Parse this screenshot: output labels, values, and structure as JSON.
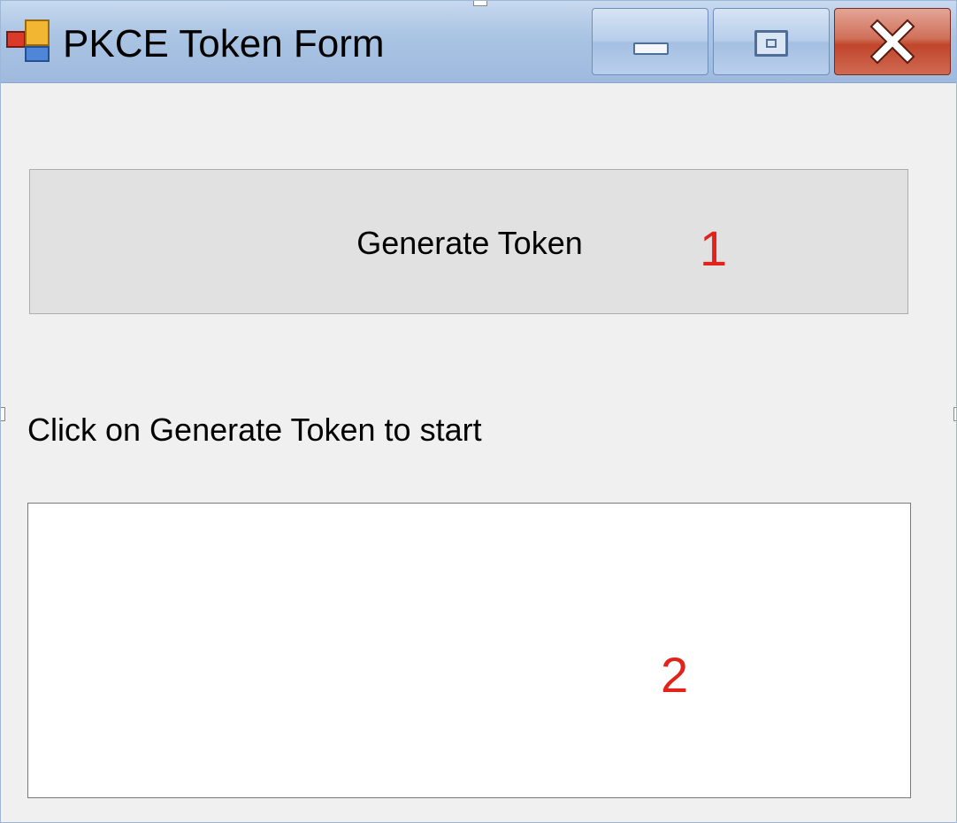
{
  "window": {
    "title": "PKCE Token Form"
  },
  "titlebar": {
    "icon": "app-icon",
    "minimize_icon": "minimize-icon",
    "maximize_icon": "maximize-icon",
    "close_icon": "close-icon"
  },
  "form": {
    "generate_button_label": "Generate Token",
    "status_text": "Click on Generate Token to start",
    "token_output_value": ""
  },
  "annotations": {
    "marker_1": "1",
    "marker_2": "2",
    "color": "#e3231b"
  },
  "colors": {
    "titlebar": "#a9c3e3",
    "close_button": "#c0452b",
    "form_background": "#f0f0f0",
    "button_background": "#e1e1e1"
  }
}
